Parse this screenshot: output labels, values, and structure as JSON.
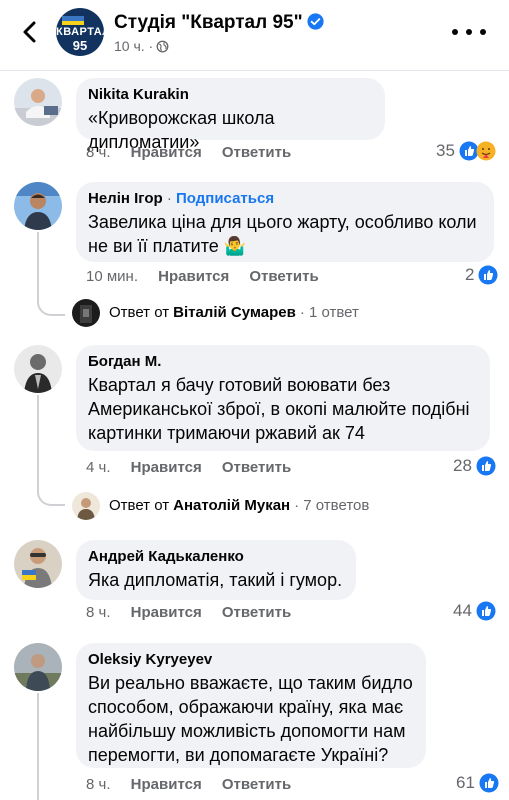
{
  "header": {
    "page_name": "Студія \"Квартал 95\"",
    "meta_time": "10 ч. ·",
    "avatar_line1": "КВАРТАЛ",
    "avatar_line2": "95",
    "avatar_top": "СТУДІЯ"
  },
  "comments": [
    {
      "author": "Nikita Kurakin",
      "text": "«Криворожская школа дипломатии»",
      "time": "8 ч.",
      "like_label": "Нравится",
      "reply_label": "Ответить",
      "reactions": "35"
    },
    {
      "author": "Нелін Ігор",
      "follow": "Подписаться",
      "text": "Завелика ціна для цього жарту, особливо коли не ви її платите 🤷‍♂️",
      "time": "10 мин.",
      "like_label": "Нравится",
      "reply_label": "Ответить",
      "reactions": "2",
      "reply_prefix": "Ответ от",
      "reply_author": "Віталій Сумарев",
      "reply_count": "· 1 ответ"
    },
    {
      "author": "Богдан М.",
      "text": "Квартал я бачу готовий воювати без Американськоï зброї, в окопі малюйте подібні картинки тримаючи ржавий ак 74",
      "time": "4 ч.",
      "like_label": "Нравится",
      "reply_label": "Ответить",
      "reactions": "28",
      "reply_prefix": "Ответ от",
      "reply_author": "Анатолій Мукан",
      "reply_count": "· 7 ответов"
    },
    {
      "author": "Андрей Кадькаленко",
      "text": "Яка дипломатія, такий і гумор.",
      "time": "8 ч.",
      "like_label": "Нравится",
      "reply_label": "Ответить",
      "reactions": "44"
    },
    {
      "author": "Oleksiy Kyryeyev",
      "text": "Ви реально вважаєте, що таким бидло способом, ображаючи країну, яка має найбільшу можливість допомогти нам перемогти, ви допомагаєте Україні?",
      "time": "8 ч.",
      "like_label": "Нравится",
      "reply_label": "Ответить",
      "reactions": "61"
    }
  ],
  "colors": {
    "link_blue": "#1877f2",
    "bubble_bg": "#f0f2f5",
    "secondary_text": "#65676b"
  }
}
